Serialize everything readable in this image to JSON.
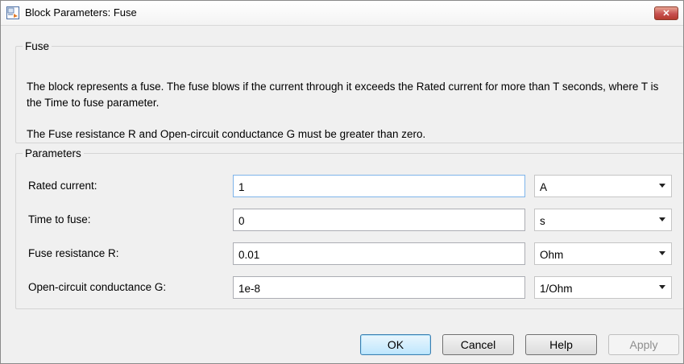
{
  "window": {
    "title": "Block Parameters: Fuse",
    "close_label": "✕"
  },
  "description": {
    "group_title": "Fuse",
    "text1": "The block represents a fuse. The fuse blows if the current through it exceeds the Rated current for more than T seconds, where T is the Time to fuse parameter.",
    "text2": "The Fuse resistance R and Open-circuit conductance G must be greater than zero."
  },
  "parameters": {
    "group_title": "Parameters",
    "rows": [
      {
        "label": "Rated current:",
        "value": "1",
        "unit": "A"
      },
      {
        "label": "Time to fuse:",
        "value": "0",
        "unit": "s"
      },
      {
        "label": "Fuse resistance R:",
        "value": "0.01",
        "unit": "Ohm"
      },
      {
        "label": "Open-circuit conductance G:",
        "value": "1e-8",
        "unit": "1/Ohm"
      }
    ]
  },
  "buttons": {
    "ok": "OK",
    "cancel": "Cancel",
    "help": "Help",
    "apply": "Apply"
  },
  "colors": {
    "accent": "#3c7fb1",
    "close": "#c75050"
  }
}
